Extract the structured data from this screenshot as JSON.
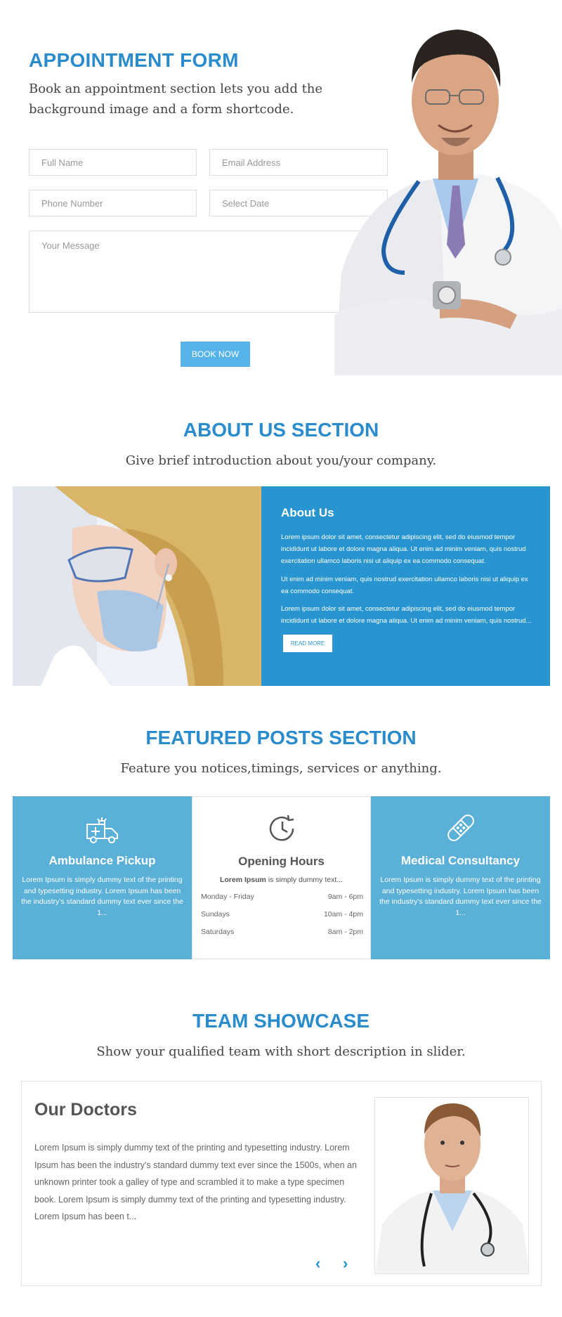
{
  "appointment": {
    "title": "APPOINTMENT FORM",
    "subtitle": "Book an appointment section lets you add the background image and a form shortcode.",
    "fields": {
      "full_name": "Full Name",
      "email": "Email Address",
      "phone": "Phone Number",
      "date": "Select Date",
      "message": "Your Message"
    },
    "button": "BOOK NOW"
  },
  "about": {
    "title": "ABOUT US SECTION",
    "subtitle": "Give brief introduction about you/your company.",
    "box_heading": "About Us",
    "paragraphs": [
      "Lorem ipsum dolor sit amet, consectetur adipiscing elit, sed do eiusmod tempor incididunt ut labore et dolore magna aliqua. Ut enim ad minim veniam, quis nostrud exercitation ullamco laboris nisi ut aliquip ex ea commodo consequat.",
      "Ut enim ad minim veniam, quis nostrud exercitation ullamco laboris nisi ut aliquip ex ea commodo consequat.",
      "Lorem ipsum dolor sit amet, consectetur adipiscing elit, sed do eiusmod tempor incididunt ut labore et dolore magna aliqua. Ut enim ad minim veniam, quis nostrud..."
    ],
    "read_more": "READ MORE"
  },
  "featured": {
    "title": "FEATURED POSTS SECTION",
    "subtitle": "Feature you notices,timings, services or anything.",
    "cards": [
      {
        "title": "Ambulance Pickup",
        "text": "Lorem Ipsum is simply dummy text of the printing and typesetting industry. Lorem Ipsum has been the industry's standard dummy text ever since the 1...",
        "icon": "ambulance-icon"
      },
      {
        "title": "Opening Hours",
        "intro_bold": "Lorem Ipsum",
        "intro_rest": " is simply dummy text...",
        "icon": "clock-icon",
        "hours": [
          {
            "day": "Monday - Friday",
            "time": "9am - 6pm"
          },
          {
            "day": "Sundays",
            "time": "10am - 4pm"
          },
          {
            "day": "Saturdays",
            "time": "8am - 2pm"
          }
        ]
      },
      {
        "title": "Medical Consultancy",
        "text": "Lorem Ipsum is simply dummy text of the printing and typesetting industry. Lorem Ipsum has been the industry's standard dummy text ever since the 1...",
        "icon": "bandage-icon"
      }
    ]
  },
  "team": {
    "title": "TEAM SHOWCASE",
    "subtitle": "Show your qualified team with short description in slider.",
    "heading": "Our Doctors",
    "text": "Lorem Ipsum is simply dummy text of the printing and typesetting industry. Lorem Ipsum has been the industry's standard dummy text ever since the 1500s, when an unknown printer took a galley of type and scrambled it to make a type specimen book. Lorem Ipsum is simply dummy text of the printing and typesetting industry. Lorem Ipsum has been t...",
    "prev": "‹",
    "next": "›"
  },
  "colors": {
    "accent": "#2a8ccc",
    "about_box": "#2895d1",
    "feature_blue": "#5bb0d8",
    "button_blue": "#56b3ea"
  }
}
